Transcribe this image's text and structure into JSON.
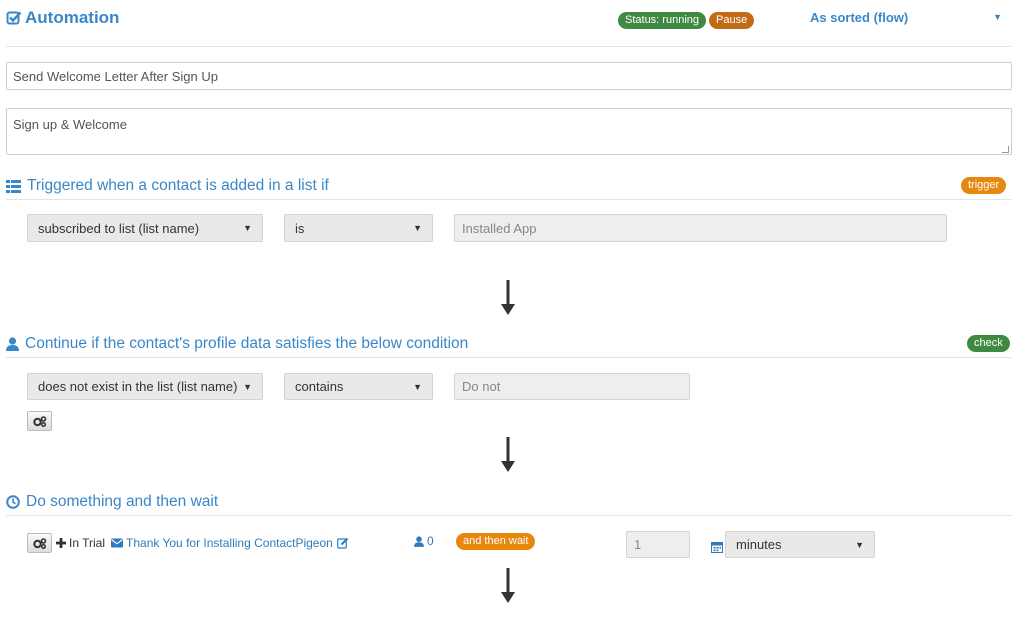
{
  "header": {
    "title": "Automation",
    "status": "Status: running",
    "pause_label": "Pause",
    "sort_label": "As sorted (flow)"
  },
  "form": {
    "name_value": "Send Welcome Letter After Sign Up",
    "description_value": "Sign up & Welcome"
  },
  "trigger": {
    "title": "Triggered when a contact is added in a list if",
    "badge": "trigger",
    "condition_field": "subscribed to list (list name)",
    "operator": "is",
    "value": "Installed App"
  },
  "check": {
    "title": "Continue if the contact's profile data satisfies the below condition",
    "badge": "check",
    "condition_field": "does not exist in the list (list name)",
    "operator": "contains",
    "value": "Do not"
  },
  "action": {
    "title": "Do something and then wait",
    "tag": "In Trial",
    "email_name": "Thank You for Installing ContactPigeon",
    "count": "0",
    "wait_badge": "and then wait",
    "wait_value": "1",
    "wait_unit": "minutes"
  },
  "colors": {
    "accent": "#3a87c8",
    "running": "#3f8a43",
    "trigger": "#e8870e",
    "pause": "#c26a16"
  }
}
